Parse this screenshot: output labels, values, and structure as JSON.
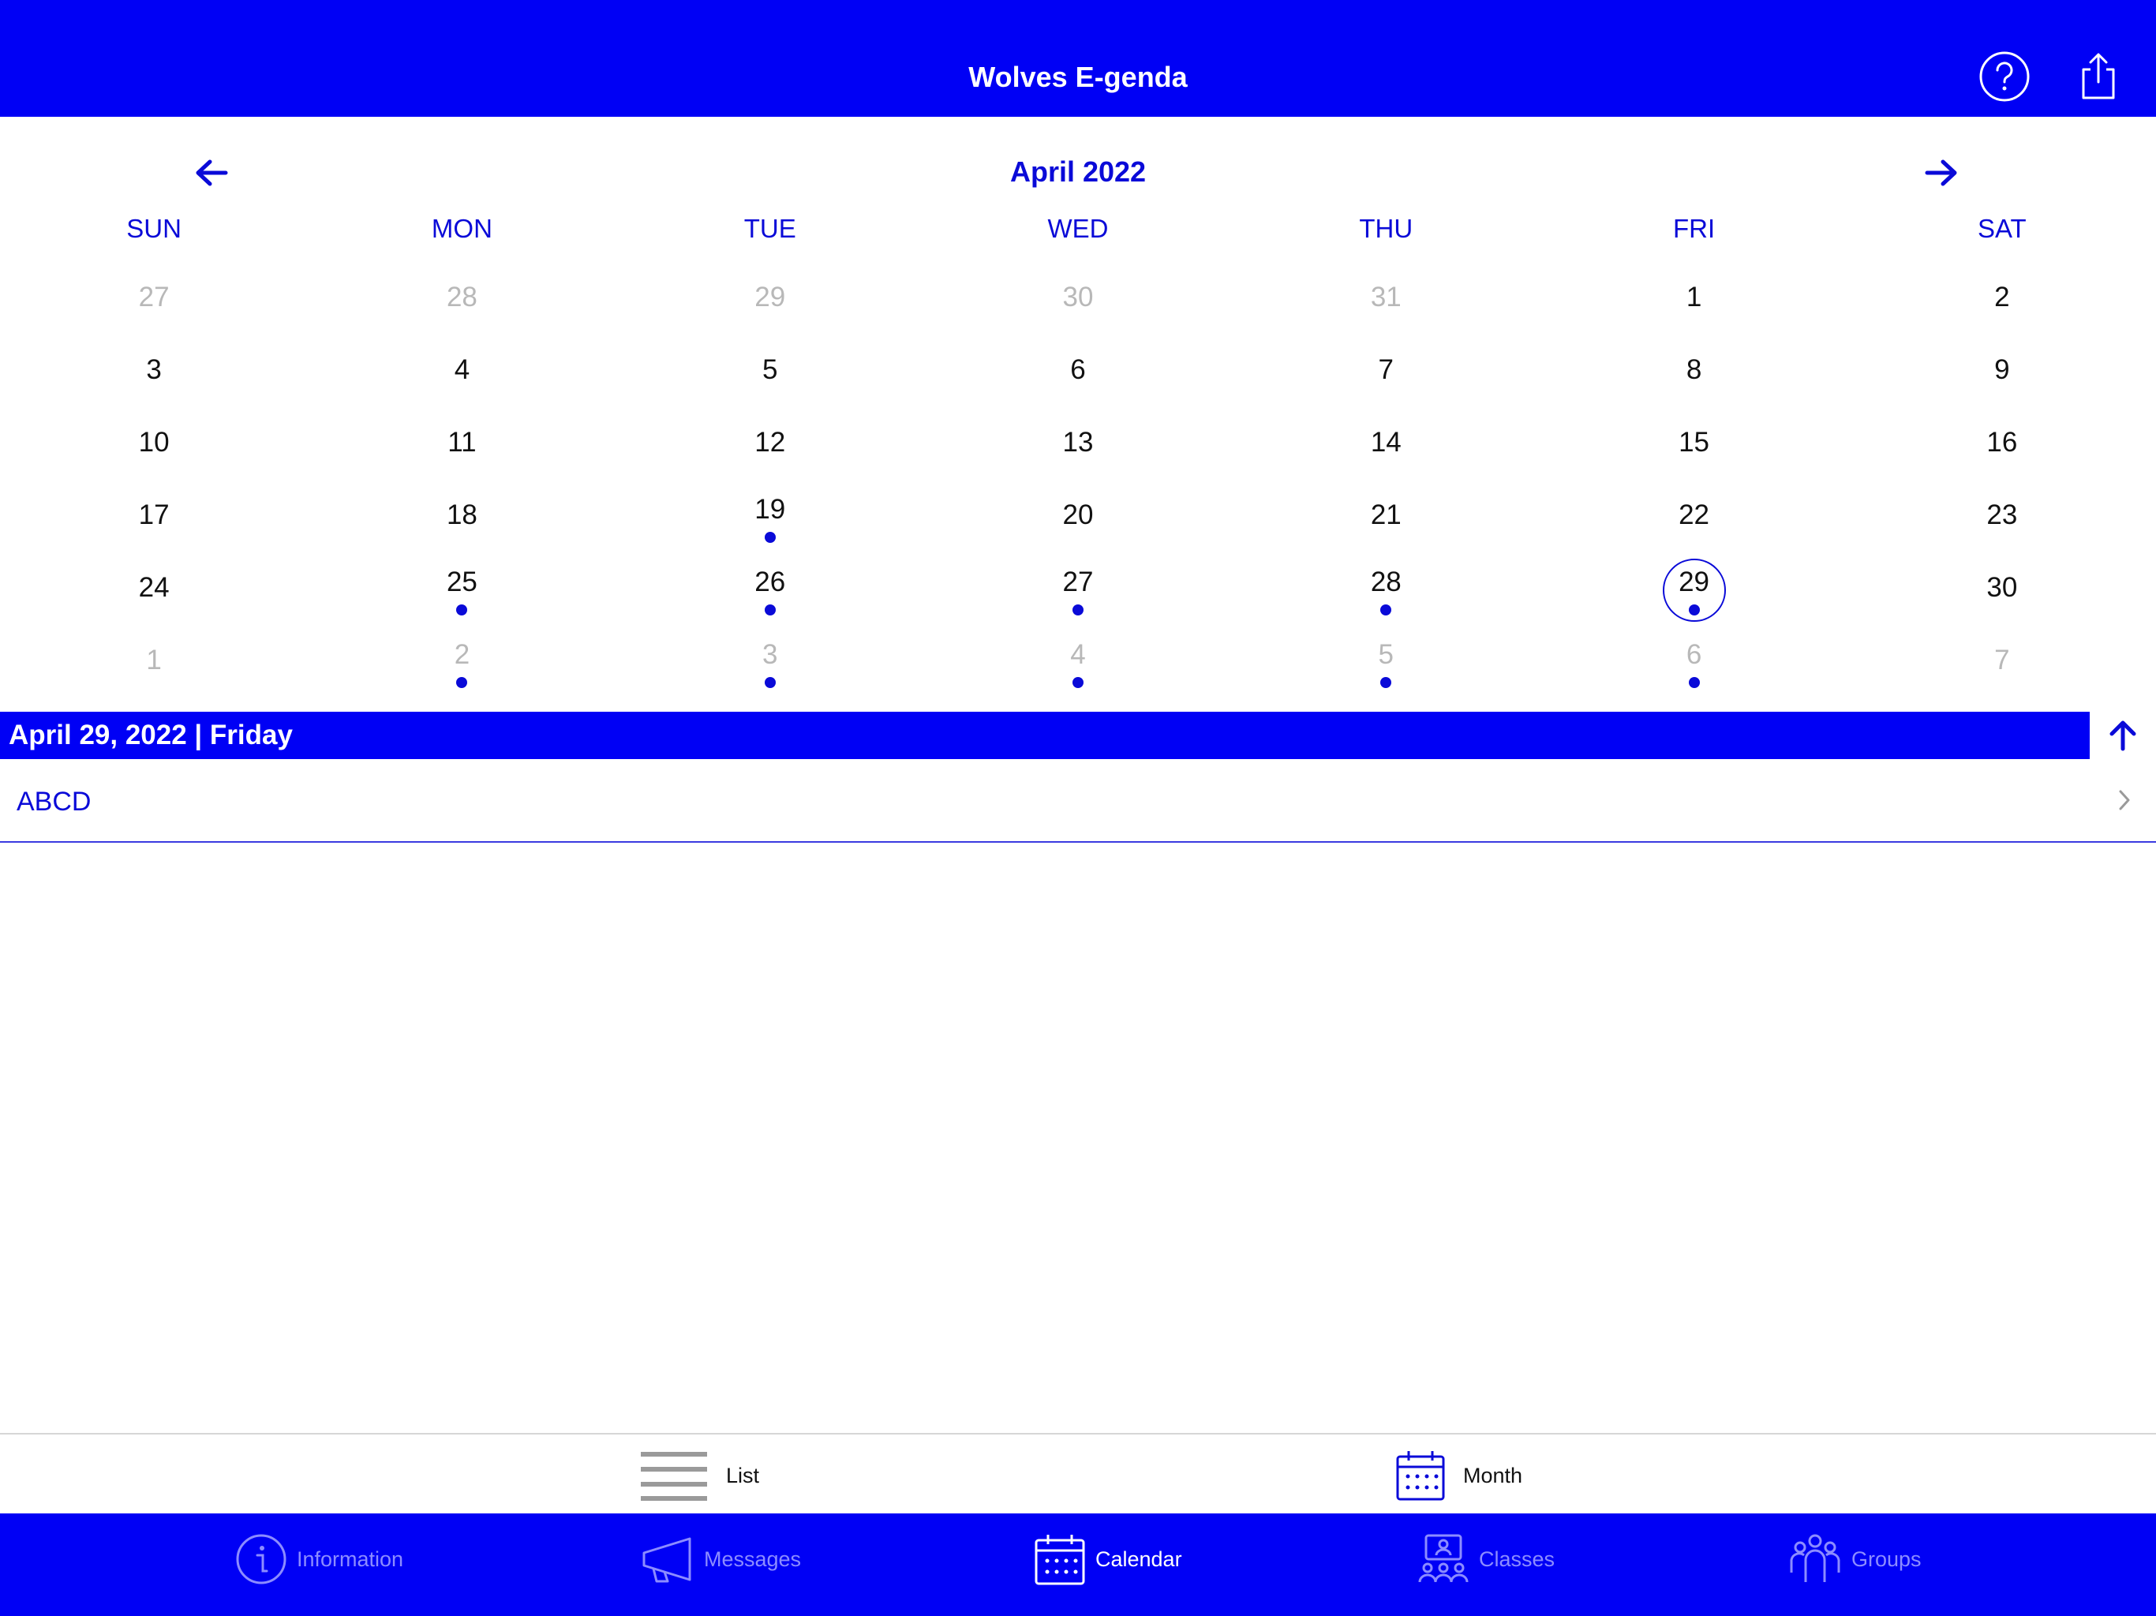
{
  "header": {
    "title": "Wolves E-genda",
    "help_icon": "question-circle-icon",
    "share_icon": "share-icon"
  },
  "calendar": {
    "month_title": "April 2022",
    "weekdays": [
      "SUN",
      "MON",
      "TUE",
      "WED",
      "THU",
      "FRI",
      "SAT"
    ],
    "weeks": [
      [
        {
          "d": "27",
          "m": true,
          "e": false
        },
        {
          "d": "28",
          "m": true,
          "e": false
        },
        {
          "d": "29",
          "m": true,
          "e": false
        },
        {
          "d": "30",
          "m": true,
          "e": false
        },
        {
          "d": "31",
          "m": true,
          "e": false
        },
        {
          "d": "1",
          "m": false,
          "e": false
        },
        {
          "d": "2",
          "m": false,
          "e": false
        }
      ],
      [
        {
          "d": "3",
          "m": false,
          "e": false
        },
        {
          "d": "4",
          "m": false,
          "e": false
        },
        {
          "d": "5",
          "m": false,
          "e": false
        },
        {
          "d": "6",
          "m": false,
          "e": false
        },
        {
          "d": "7",
          "m": false,
          "e": false
        },
        {
          "d": "8",
          "m": false,
          "e": false
        },
        {
          "d": "9",
          "m": false,
          "e": false
        }
      ],
      [
        {
          "d": "10",
          "m": false,
          "e": false
        },
        {
          "d": "11",
          "m": false,
          "e": false
        },
        {
          "d": "12",
          "m": false,
          "e": false
        },
        {
          "d": "13",
          "m": false,
          "e": false
        },
        {
          "d": "14",
          "m": false,
          "e": false
        },
        {
          "d": "15",
          "m": false,
          "e": false
        },
        {
          "d": "16",
          "m": false,
          "e": false
        }
      ],
      [
        {
          "d": "17",
          "m": false,
          "e": false
        },
        {
          "d": "18",
          "m": false,
          "e": false
        },
        {
          "d": "19",
          "m": false,
          "e": true
        },
        {
          "d": "20",
          "m": false,
          "e": false
        },
        {
          "d": "21",
          "m": false,
          "e": false
        },
        {
          "d": "22",
          "m": false,
          "e": false
        },
        {
          "d": "23",
          "m": false,
          "e": false
        }
      ],
      [
        {
          "d": "24",
          "m": false,
          "e": false
        },
        {
          "d": "25",
          "m": false,
          "e": true
        },
        {
          "d": "26",
          "m": false,
          "e": true
        },
        {
          "d": "27",
          "m": false,
          "e": true
        },
        {
          "d": "28",
          "m": false,
          "e": true
        },
        {
          "d": "29",
          "m": false,
          "e": true,
          "selected": true
        },
        {
          "d": "30",
          "m": false,
          "e": false
        }
      ],
      [
        {
          "d": "1",
          "m": true,
          "e": false
        },
        {
          "d": "2",
          "m": true,
          "e": true
        },
        {
          "d": "3",
          "m": true,
          "e": true
        },
        {
          "d": "4",
          "m": true,
          "e": true
        },
        {
          "d": "5",
          "m": true,
          "e": true
        },
        {
          "d": "6",
          "m": true,
          "e": true
        },
        {
          "d": "7",
          "m": true,
          "e": false
        }
      ]
    ]
  },
  "selected_date": {
    "label": "April 29, 2022 | Friday"
  },
  "events": [
    {
      "title": "ABCD"
    }
  ],
  "view_switch": {
    "list_label": "List",
    "month_label": "Month"
  },
  "tabs": [
    {
      "label": "Information",
      "icon": "info-circle-icon",
      "active": false
    },
    {
      "label": "Messages",
      "icon": "megaphone-icon",
      "active": false
    },
    {
      "label": "Calendar",
      "icon": "calendar-icon",
      "active": true
    },
    {
      "label": "Classes",
      "icon": "classes-icon",
      "active": false
    },
    {
      "label": "Groups",
      "icon": "groups-icon",
      "active": false
    }
  ],
  "colors": {
    "brand_blue": "#0000f5",
    "accent_text": "#0a0ad8",
    "muted_day": "#b8b8b8",
    "inactive_tab": "#8c8cff"
  }
}
